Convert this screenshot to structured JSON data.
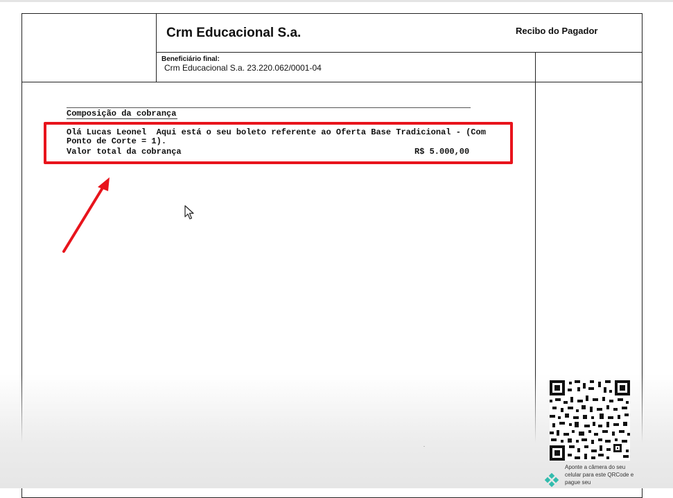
{
  "header": {
    "company_name": "Crm Educacional S.a.",
    "receipt_label": "Recibo do Pagador",
    "beneficiary_label": "Beneficiário final:",
    "beneficiary_value": "Crm Educacional S.a. 23.220.062/0001-04"
  },
  "composition": {
    "title": "Composição da cobrança",
    "description": "Olá Lucas Leonel  Aqui está o seu boleto referente ao Oferta Base Tradicional - (Com Ponto de Corte = 1).",
    "total_label": "Valor total da cobrança",
    "total_value": "R$ 5.000,00"
  },
  "qr": {
    "note": "Aponte a câmera do seu celular para este QRCode e pague seu"
  },
  "colors": {
    "annotation_red": "#e8141c",
    "pix_teal": "#32bcad"
  },
  "icons": [
    "mouse-cursor-icon",
    "annotation-arrow-icon",
    "pix-icon",
    "qr-code"
  ]
}
